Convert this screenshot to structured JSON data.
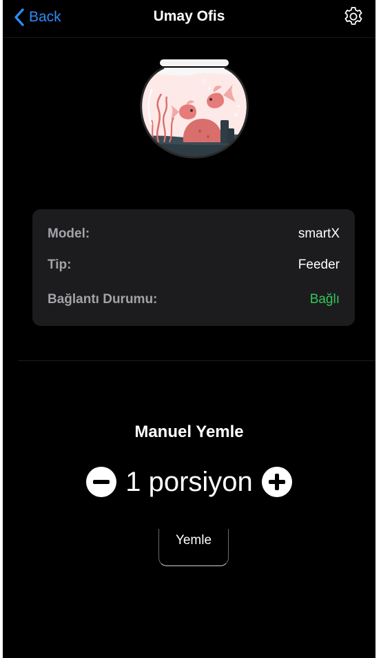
{
  "nav": {
    "back_label": "Back",
    "title": "Umay Ofis",
    "settings_icon": "gear-icon",
    "back_icon": "chevron-left-icon",
    "accent_color": "#2f8cf7"
  },
  "device": {
    "image_icon": "fish-bowl-illustration",
    "rows": [
      {
        "label": "Model:",
        "value": "smartX"
      },
      {
        "label": "Tip:",
        "value": "Feeder"
      },
      {
        "label": "Bağlantı Durumu:",
        "value": "Bağlı",
        "status_color": "#34c759"
      }
    ]
  },
  "manual_feed": {
    "title": "Manuel Yemle",
    "portion_text": "1 porsiyon",
    "minus_icon": "minus-circle-icon",
    "plus_icon": "plus-circle-icon",
    "feed_button_label": "Yemle"
  }
}
